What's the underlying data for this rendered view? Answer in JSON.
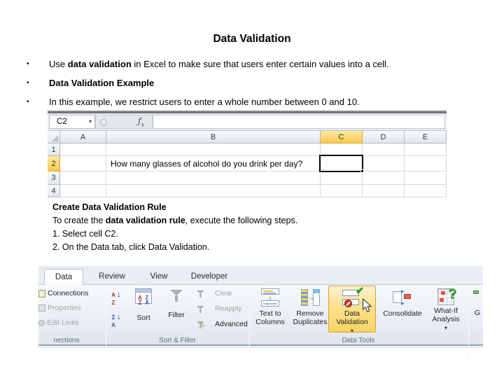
{
  "title": "Data Validation",
  "bullets": {
    "marker": "•",
    "b1": {
      "pre": "Use ",
      "bold": "data validation",
      "post": " in Excel to make sure that users enter certain values into a cell."
    },
    "b2": {
      "pre": "",
      "bold": "Data Validation Example",
      "post": ""
    },
    "b3": {
      "pre": "In this example, we restrict users to enter a whole number between 0 and 10.",
      "bold": "",
      "post": ""
    }
  },
  "spreadsheet": {
    "name_box_value": "C2",
    "column_headers": [
      "A",
      "B",
      "C",
      "D",
      "E"
    ],
    "row_headers": [
      "1",
      "2",
      "3",
      "4"
    ],
    "cells": {
      "B2": "How many glasses of alcohol do you drink per day?"
    },
    "selected_cell": "C2"
  },
  "instructions": {
    "heading": "Create Data Validation Rule",
    "line1": {
      "pre": "To create the ",
      "bold": "data validation rule",
      "post": ", execute the following steps."
    },
    "step1": "1. Select cell C2.",
    "step2": "2. On the Data tab, click Data Validation."
  },
  "ribbon": {
    "tabs": {
      "data": "Data",
      "review": "Review",
      "view": "View",
      "developer": "Developer"
    },
    "connections_group": {
      "connections": "Connections",
      "properties": "Properties",
      "edit_links": "Edit Links",
      "group_label": "nections"
    },
    "sort_filter_group": {
      "sort": "Sort",
      "filter": "Filter",
      "clear": "Clear",
      "reapply": "Reapply",
      "advanced": "Advanced",
      "group_label": "Sort & Filter"
    },
    "data_tools_group": {
      "text_to_columns": "Text to Columns",
      "remove_duplicates": "Remove Duplicates",
      "data_validation": "Data Validation",
      "consolidate": "Consolidate",
      "what_if_analysis": "What-If Analysis",
      "group_label": "Data Tools"
    },
    "partial_group_label": "G"
  },
  "icons": {
    "caret_down": "▾",
    "arrow_down": "↓",
    "letter_a": "A",
    "letter_z": "Z",
    "check": "✔",
    "x_mark": "✕",
    "pencil": "✎",
    "arrow_right": "▸",
    "question": "?",
    "fx": "ƒ",
    "fx_sub": "x"
  },
  "colors": {
    "header_highlight": "#f8c94f",
    "selection_border": "#000000",
    "button_highlight_border": "#d5a028"
  }
}
